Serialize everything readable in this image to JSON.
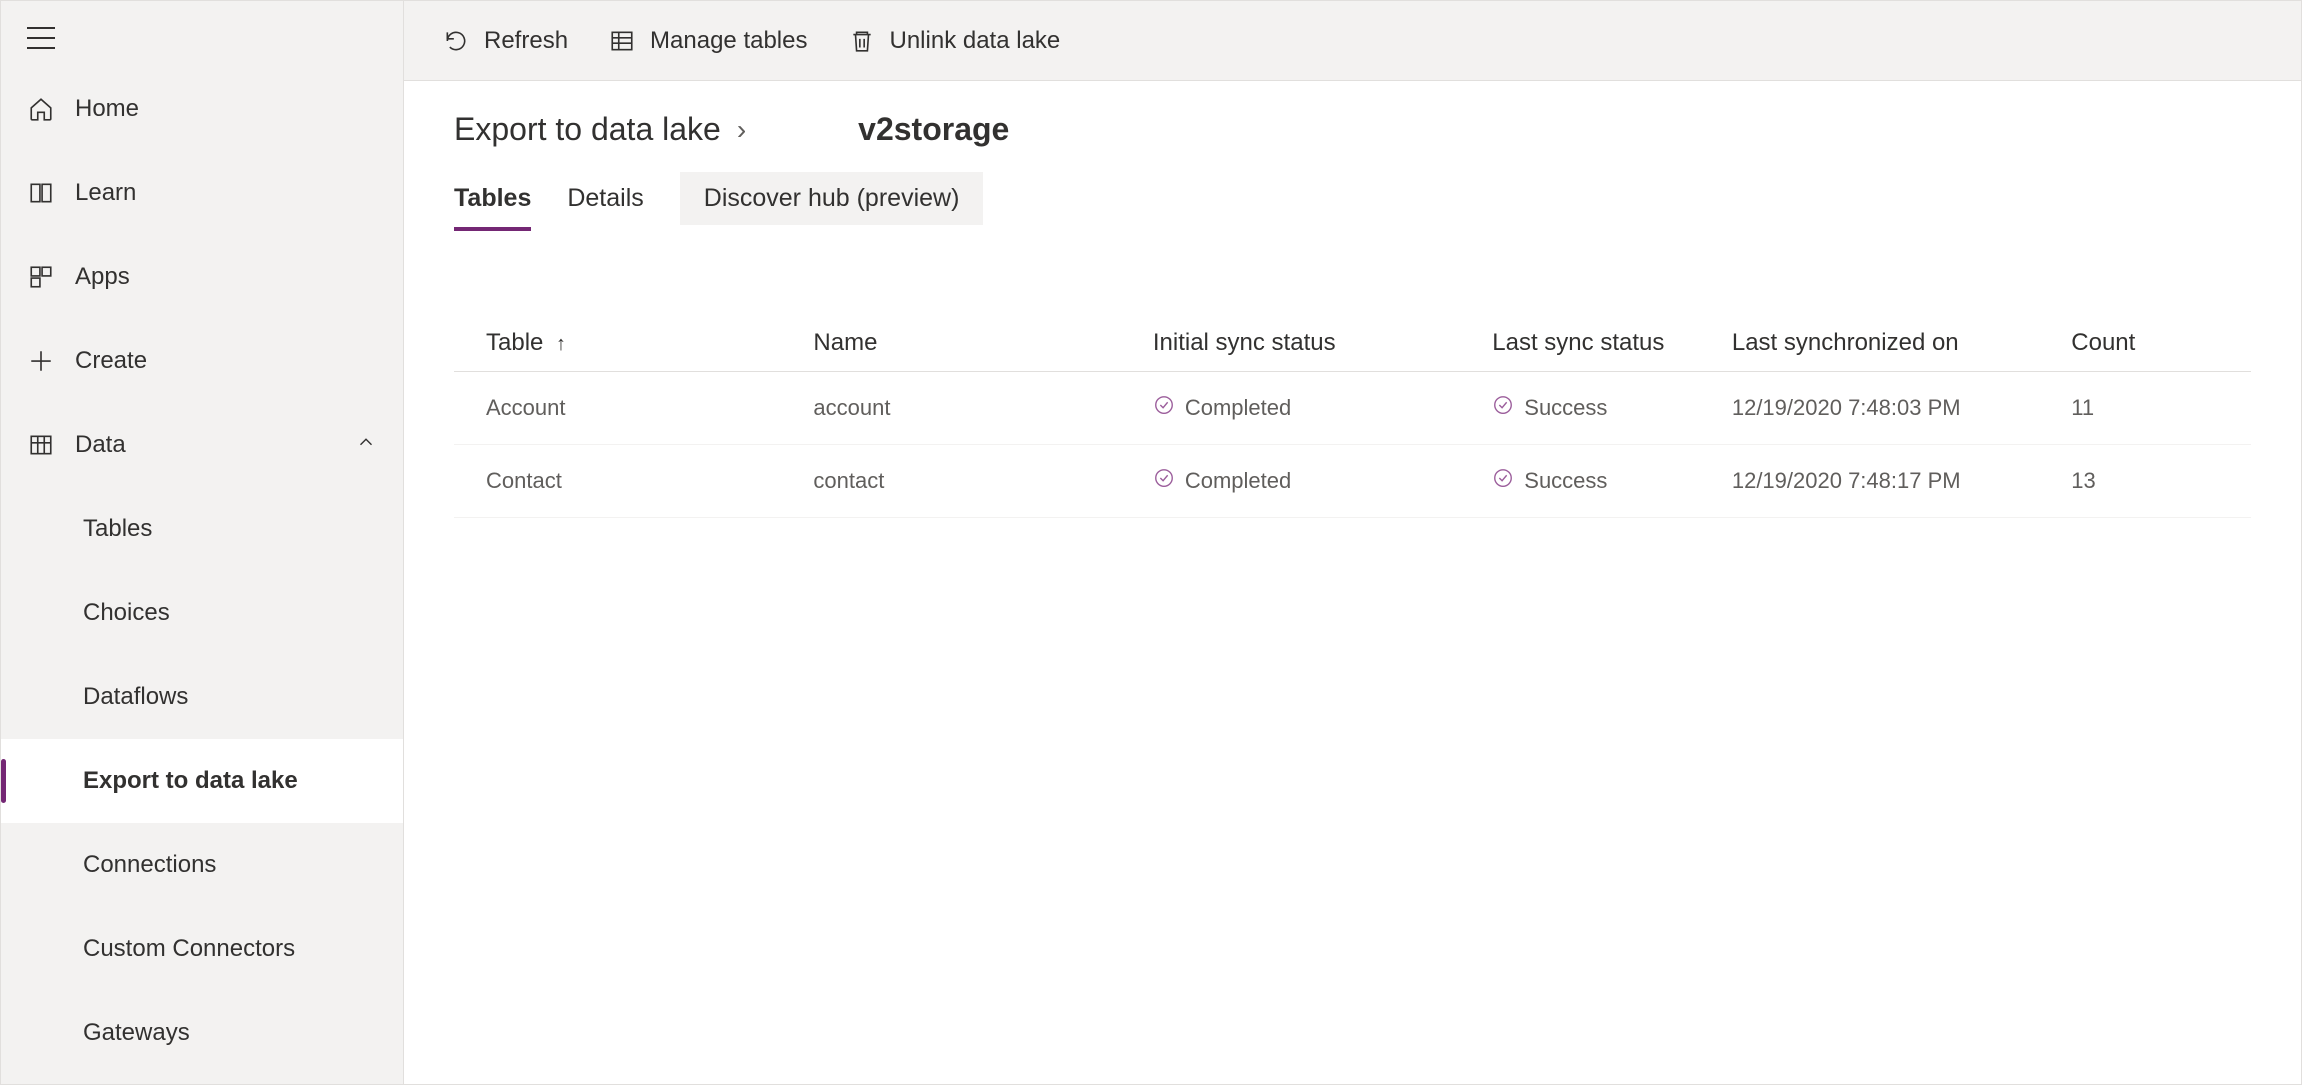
{
  "sidebar": {
    "items": [
      {
        "label": "Home"
      },
      {
        "label": "Learn"
      },
      {
        "label": "Apps"
      },
      {
        "label": "Create"
      },
      {
        "label": "Data"
      }
    ],
    "data_subitems": [
      {
        "label": "Tables"
      },
      {
        "label": "Choices"
      },
      {
        "label": "Dataflows"
      },
      {
        "label": "Export to data lake"
      },
      {
        "label": "Connections"
      },
      {
        "label": "Custom Connectors"
      },
      {
        "label": "Gateways"
      }
    ]
  },
  "toolbar": {
    "refresh": "Refresh",
    "manage": "Manage tables",
    "unlink": "Unlink data lake"
  },
  "breadcrumb": {
    "root": "Export to data lake",
    "suffix": "v2storage"
  },
  "tabs": [
    {
      "label": "Tables"
    },
    {
      "label": "Details"
    },
    {
      "label": "Discover hub (preview)"
    }
  ],
  "table": {
    "headers": {
      "table": "Table",
      "name": "Name",
      "initial_sync": "Initial sync status",
      "last_sync": "Last sync status",
      "last_synced_on": "Last synchronized on",
      "count": "Count"
    },
    "rows": [
      {
        "table": "Account",
        "name": "account",
        "initial": "Completed",
        "last": "Success",
        "ts": "12/19/2020 7:48:03 PM",
        "count": "11"
      },
      {
        "table": "Contact",
        "name": "contact",
        "initial": "Completed",
        "last": "Success",
        "ts": "12/19/2020 7:48:17 PM",
        "count": "13"
      }
    ]
  }
}
